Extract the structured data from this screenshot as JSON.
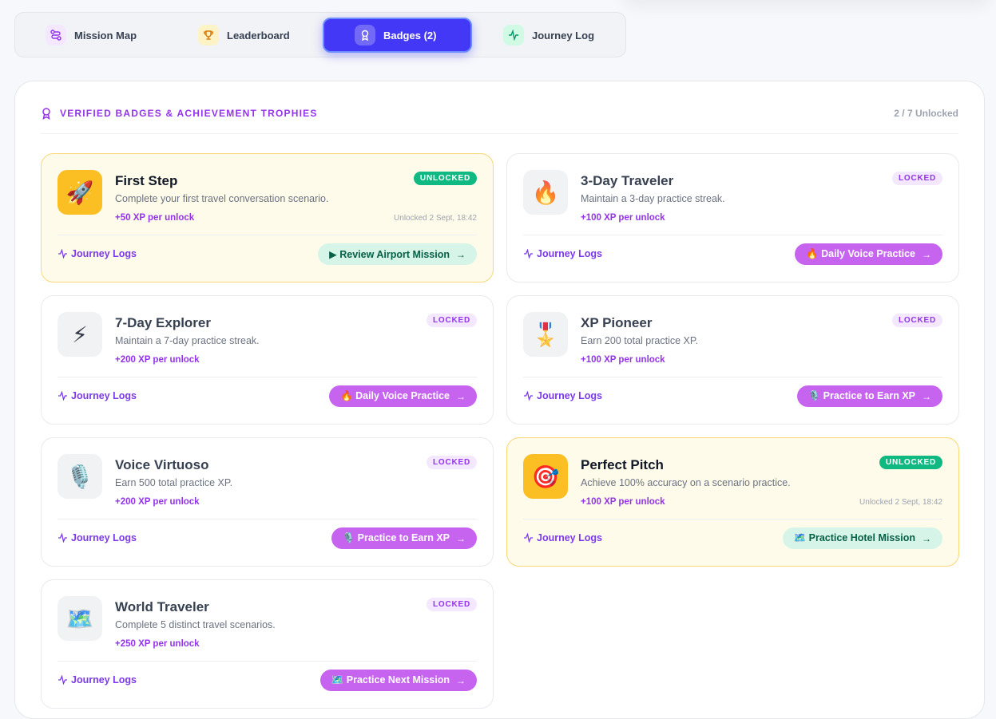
{
  "tabs": [
    {
      "label": "Mission Map",
      "icon": "route-icon"
    },
    {
      "label": "Leaderboard",
      "icon": "trophy-icon"
    },
    {
      "label": "Badges (2)",
      "icon": "badge-icon"
    },
    {
      "label": "Journey Log",
      "icon": "activity-icon"
    }
  ],
  "panel": {
    "title": "VERIFIED BADGES & ACHIEVEMENT TROPHIES",
    "count": "2 / 7 Unlocked"
  },
  "badges": [
    {
      "title": "First Step",
      "desc": "Complete your first travel conversation scenario.",
      "xp": "+50 XP per unlock",
      "status": "UNLOCKED",
      "date": "Unlocked 2 Sept, 18:42",
      "logs": "Journey Logs",
      "action": "▶ Review Airport Mission",
      "emoji": "🚀"
    },
    {
      "title": "3-Day Traveler",
      "desc": "Maintain a 3-day practice streak.",
      "xp": "+100 XP per unlock",
      "status": "LOCKED",
      "date": "",
      "logs": "Journey Logs",
      "action": "🔥 Daily Voice Practice",
      "emoji": "🔥"
    },
    {
      "title": "7-Day Explorer",
      "desc": "Maintain a 7-day practice streak.",
      "xp": "+200 XP per unlock",
      "status": "LOCKED",
      "date": "",
      "logs": "Journey Logs",
      "action": "🔥 Daily Voice Practice",
      "emoji": "⚡"
    },
    {
      "title": "XP Pioneer",
      "desc": "Earn 200 total practice XP.",
      "xp": "+100 XP per unlock",
      "status": "LOCKED",
      "date": "",
      "logs": "Journey Logs",
      "action": "🎙️ Practice to Earn XP",
      "emoji": "🎖️"
    },
    {
      "title": "Voice Virtuoso",
      "desc": "Earn 500 total practice XP.",
      "xp": "+200 XP per unlock",
      "status": "LOCKED",
      "date": "",
      "logs": "Journey Logs",
      "action": "🎙️ Practice to Earn XP",
      "emoji": "🎙️"
    },
    {
      "title": "Perfect Pitch",
      "desc": "Achieve 100% accuracy on a scenario practice.",
      "xp": "+100 XP per unlock",
      "status": "UNLOCKED",
      "date": "Unlocked 2 Sept, 18:42",
      "logs": "Journey Logs",
      "action": "🗺️ Practice Hotel Mission",
      "emoji": "🎯"
    },
    {
      "title": "World Traveler",
      "desc": "Complete 5 distinct travel scenarios.",
      "xp": "+250 XP per unlock",
      "status": "LOCKED",
      "date": "",
      "logs": "Journey Logs",
      "action": "🗺️ Practice Next Mission",
      "emoji": "🗺️"
    }
  ]
}
